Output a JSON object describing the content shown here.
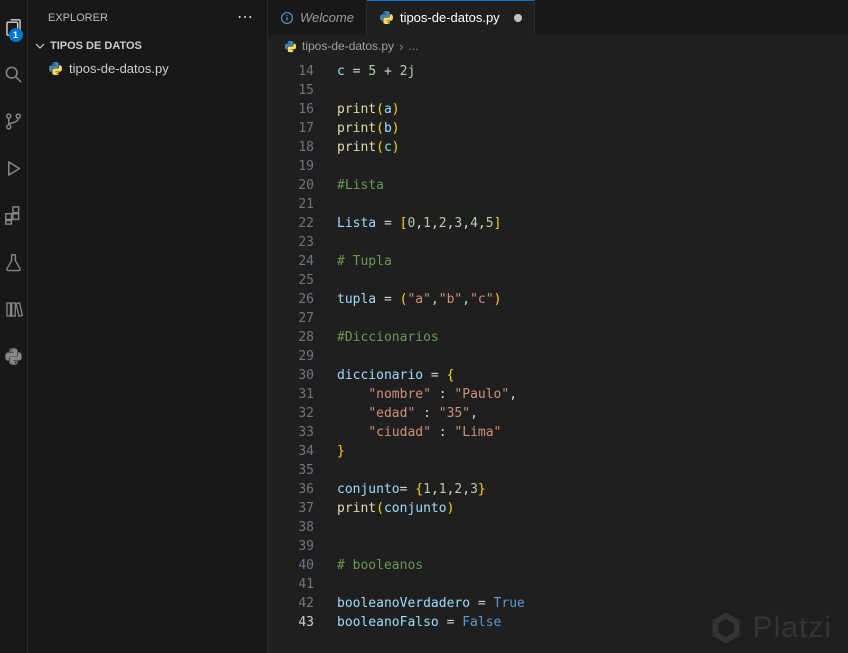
{
  "activity_bar": {
    "badge": "1",
    "items": [
      {
        "name": "explorer",
        "icon": "files-icon",
        "active": true
      },
      {
        "name": "search",
        "icon": "search-icon",
        "active": false
      },
      {
        "name": "source-control",
        "icon": "git-branch-icon",
        "active": false
      },
      {
        "name": "run-debug",
        "icon": "play-debug-icon",
        "active": false
      },
      {
        "name": "extensions",
        "icon": "extensions-icon",
        "active": false
      },
      {
        "name": "testing",
        "icon": "beaker-icon",
        "active": false
      },
      {
        "name": "library",
        "icon": "book-icon",
        "active": false
      },
      {
        "name": "python-extension",
        "icon": "python-icon",
        "active": false
      }
    ]
  },
  "sidebar": {
    "title": "EXPLORER",
    "section": "TIPOS DE DATOS",
    "file": "tipos-de-datos.py"
  },
  "icons": {
    "more_actions": "⋯",
    "breadcrumb_separator": "›"
  },
  "tabs": [
    {
      "label": "Welcome",
      "active": false,
      "preview": true,
      "dirty": false
    },
    {
      "label": "tipos-de-datos.py",
      "active": true,
      "preview": false,
      "dirty": true
    }
  ],
  "breadcrumb": {
    "file": "tipos-de-datos.py",
    "more": "..."
  },
  "colors": {
    "accent": "#0078d4",
    "editor_bg": "#1f1f1f",
    "side_bg": "#181818",
    "python_blue": "#4584b6",
    "python_yellow": "#ffde57"
  },
  "editor": {
    "language": "python",
    "active_line": 43,
    "lines": [
      {
        "n": 14,
        "t": [
          [
            "v",
            "c"
          ],
          [
            "o",
            " = "
          ],
          [
            "n",
            "5"
          ],
          [
            "o",
            " + "
          ],
          [
            "n",
            "2j"
          ]
        ]
      },
      {
        "n": 15,
        "t": []
      },
      {
        "n": 16,
        "t": [
          [
            "f",
            "print"
          ],
          [
            "p",
            "("
          ],
          [
            "v",
            "a"
          ],
          [
            "p",
            ")"
          ]
        ]
      },
      {
        "n": 17,
        "t": [
          [
            "f",
            "print"
          ],
          [
            "p",
            "("
          ],
          [
            "v",
            "b"
          ],
          [
            "p",
            ")"
          ]
        ]
      },
      {
        "n": 18,
        "t": [
          [
            "f",
            "print"
          ],
          [
            "p",
            "("
          ],
          [
            "v",
            "c"
          ],
          [
            "p",
            ")"
          ]
        ]
      },
      {
        "n": 19,
        "t": []
      },
      {
        "n": 20,
        "t": [
          [
            "c",
            "#Lista"
          ]
        ]
      },
      {
        "n": 21,
        "t": []
      },
      {
        "n": 22,
        "t": [
          [
            "v",
            "Lista"
          ],
          [
            "o",
            " = "
          ],
          [
            "p",
            "["
          ],
          [
            "n",
            "0"
          ],
          [
            "o",
            ","
          ],
          [
            "n",
            "1"
          ],
          [
            "o",
            ","
          ],
          [
            "n",
            "2"
          ],
          [
            "o",
            ","
          ],
          [
            "n",
            "3"
          ],
          [
            "o",
            ","
          ],
          [
            "n",
            "4"
          ],
          [
            "o",
            ","
          ],
          [
            "n",
            "5"
          ],
          [
            "p",
            "]"
          ]
        ]
      },
      {
        "n": 23,
        "t": []
      },
      {
        "n": 24,
        "t": [
          [
            "c",
            "# Tupla"
          ]
        ]
      },
      {
        "n": 25,
        "t": []
      },
      {
        "n": 26,
        "t": [
          [
            "v",
            "tupla"
          ],
          [
            "o",
            " = "
          ],
          [
            "p",
            "("
          ],
          [
            "s",
            "\"a\""
          ],
          [
            "o",
            ","
          ],
          [
            "s",
            "\"b\""
          ],
          [
            "o",
            ","
          ],
          [
            "s",
            "\"c\""
          ],
          [
            "p",
            ")"
          ]
        ]
      },
      {
        "n": 27,
        "t": []
      },
      {
        "n": 28,
        "t": [
          [
            "c",
            "#Diccionarios"
          ]
        ]
      },
      {
        "n": 29,
        "t": []
      },
      {
        "n": 30,
        "t": [
          [
            "v",
            "diccionario"
          ],
          [
            "o",
            " = "
          ],
          [
            "p",
            "{"
          ]
        ]
      },
      {
        "n": 31,
        "t": [
          [
            "o",
            "    "
          ],
          [
            "s",
            "\"nombre\""
          ],
          [
            "o",
            " : "
          ],
          [
            "s",
            "\"Paulo\""
          ],
          [
            "o",
            ","
          ]
        ]
      },
      {
        "n": 32,
        "t": [
          [
            "o",
            "    "
          ],
          [
            "s",
            "\"edad\""
          ],
          [
            "o",
            " : "
          ],
          [
            "s",
            "\"35\""
          ],
          [
            "o",
            ","
          ]
        ]
      },
      {
        "n": 33,
        "t": [
          [
            "o",
            "    "
          ],
          [
            "s",
            "\"ciudad\""
          ],
          [
            "o",
            " : "
          ],
          [
            "s",
            "\"Lima\""
          ]
        ]
      },
      {
        "n": 34,
        "t": [
          [
            "p",
            "}"
          ]
        ]
      },
      {
        "n": 35,
        "t": []
      },
      {
        "n": 36,
        "t": [
          [
            "v",
            "conjunto"
          ],
          [
            "o",
            "= "
          ],
          [
            "p",
            "{"
          ],
          [
            "n",
            "1"
          ],
          [
            "o",
            ","
          ],
          [
            "n",
            "1"
          ],
          [
            "o",
            ","
          ],
          [
            "n",
            "2"
          ],
          [
            "o",
            ","
          ],
          [
            "n",
            "3"
          ],
          [
            "p",
            "}"
          ]
        ]
      },
      {
        "n": 37,
        "t": [
          [
            "f",
            "print"
          ],
          [
            "p",
            "("
          ],
          [
            "v",
            "conjunto"
          ],
          [
            "p",
            ")"
          ]
        ]
      },
      {
        "n": 38,
        "t": []
      },
      {
        "n": 39,
        "t": []
      },
      {
        "n": 40,
        "t": [
          [
            "c",
            "# booleanos"
          ]
        ]
      },
      {
        "n": 41,
        "t": []
      },
      {
        "n": 42,
        "t": [
          [
            "v",
            "booleanoVerdadero"
          ],
          [
            "o",
            " = "
          ],
          [
            "k",
            "True"
          ]
        ]
      },
      {
        "n": 43,
        "t": [
          [
            "v",
            "booleanoFalso"
          ],
          [
            "o",
            " = "
          ],
          [
            "k",
            "False"
          ]
        ]
      }
    ]
  },
  "watermark": {
    "text": "Platzi"
  }
}
